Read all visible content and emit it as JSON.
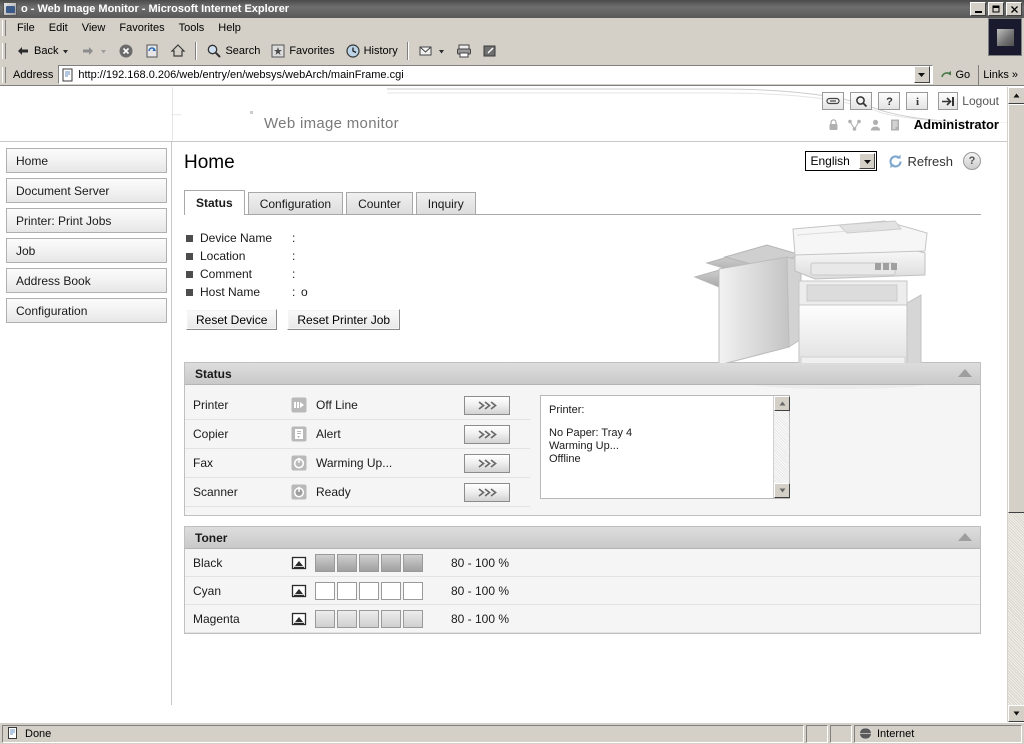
{
  "window": {
    "title": "o - Web Image Monitor - Microsoft Internet Explorer",
    "minimize_label": "_",
    "maximize_label": "❐",
    "close_label": "✕"
  },
  "menubar": {
    "items": [
      "File",
      "Edit",
      "View",
      "Favorites",
      "Tools",
      "Help"
    ]
  },
  "toolbar": {
    "back_label": "Back",
    "forward_label": "",
    "stop_label": "",
    "refresh_label": "",
    "home_label": "",
    "search_label": "Search",
    "favorites_label": "Favorites",
    "history_label": "History",
    "mail_label": "",
    "print_label": "",
    "edit_label": ""
  },
  "address": {
    "label": "Address",
    "url": "http://192.168.0.206/web/entry/en/websys/webArch/mainFrame.cgi",
    "go_label": "Go",
    "links_label": "Links",
    "links_chevron": "»"
  },
  "wim_header": {
    "product_title": "Web image monitor",
    "logout_label": "Logout",
    "user_label": "Administrator",
    "icons": [
      "link-icon",
      "search-icon",
      "help-icon",
      "info-icon",
      "logout-icon"
    ],
    "user_icons": [
      "lock-icon",
      "network-icon",
      "user-icon",
      "list-icon"
    ]
  },
  "sidebar": {
    "items": [
      {
        "label": "Home"
      },
      {
        "label": "Document Server"
      },
      {
        "label": "Printer: Print Jobs"
      },
      {
        "label": "Job"
      },
      {
        "label": "Address Book"
      },
      {
        "label": "Configuration"
      }
    ]
  },
  "main": {
    "page_title": "Home",
    "language": "English",
    "refresh_label": "Refresh",
    "help_label": "?",
    "tabs": [
      {
        "label": "Status",
        "active": true
      },
      {
        "label": "Configuration",
        "active": false
      },
      {
        "label": "Counter",
        "active": false
      },
      {
        "label": "Inquiry",
        "active": false
      }
    ],
    "device_info": [
      {
        "label": "Device Name",
        "colon": ":",
        "value": ""
      },
      {
        "label": "Location",
        "colon": ":",
        "value": ""
      },
      {
        "label": "Comment",
        "colon": ":",
        "value": ""
      },
      {
        "label": "Host Name",
        "colon": ":",
        "value": "o"
      }
    ],
    "buttons": [
      {
        "label": "Reset Device"
      },
      {
        "label": "Reset Printer Job"
      }
    ]
  },
  "status_section": {
    "title": "Status",
    "rows": [
      {
        "name": "Printer",
        "icon": "printer-status-icon",
        "state": "Off Line",
        "detail_label": "»"
      },
      {
        "name": "Copier",
        "icon": "copier-status-icon",
        "state": "Alert",
        "detail_label": "»"
      },
      {
        "name": "Fax",
        "icon": "fax-status-icon",
        "state": "Warming Up...",
        "detail_label": "»"
      },
      {
        "name": "Scanner",
        "icon": "scanner-status-icon",
        "state": "Ready",
        "detail_label": "»"
      }
    ],
    "message_box": {
      "heading": "Printer:",
      "lines": [
        "No Paper: Tray 4",
        "Warming Up...",
        "Offline"
      ]
    }
  },
  "toner_section": {
    "title": "Toner",
    "rows": [
      {
        "name": "Black",
        "icon": "toner-icon",
        "level_text": "80 - 100 %",
        "cells": [
          "full",
          "full",
          "full",
          "full",
          "full"
        ]
      },
      {
        "name": "Cyan",
        "icon": "toner-icon",
        "level_text": "80 - 100 %",
        "cells": [
          "empty",
          "empty",
          "empty",
          "empty",
          "empty"
        ]
      },
      {
        "name": "Magenta",
        "icon": "toner-icon",
        "level_text": "80 - 100 %",
        "cells": [
          "light",
          "light",
          "light",
          "light",
          "light"
        ]
      }
    ]
  },
  "statusbar": {
    "message": "Done",
    "zone": "Internet"
  }
}
